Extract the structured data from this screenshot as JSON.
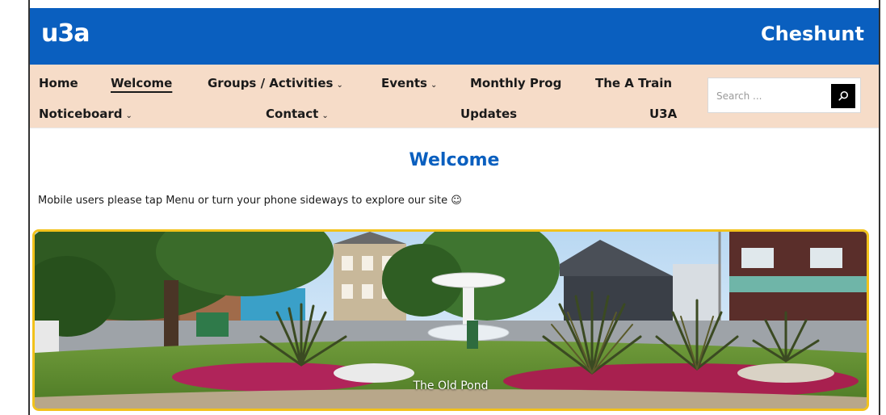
{
  "header": {
    "logo": "u3a",
    "site_name": "Cheshunt"
  },
  "nav": {
    "row1": [
      {
        "label": "Home",
        "has_dropdown": false,
        "active": false
      },
      {
        "label": "Welcome",
        "has_dropdown": false,
        "active": true
      },
      {
        "label": "Groups / Activities",
        "has_dropdown": true,
        "active": false
      },
      {
        "label": "Events",
        "has_dropdown": true,
        "active": false
      },
      {
        "label": "Monthly Prog",
        "has_dropdown": false,
        "active": false
      },
      {
        "label": "The A Train",
        "has_dropdown": false,
        "active": false
      }
    ],
    "row2": [
      {
        "label": "Noticeboard",
        "has_dropdown": true,
        "active": false
      },
      {
        "label": "Contact",
        "has_dropdown": true,
        "active": false
      },
      {
        "label": "Updates",
        "has_dropdown": false,
        "active": false
      },
      {
        "label": "U3A",
        "has_dropdown": false,
        "active": false
      }
    ],
    "chevron": "⌄"
  },
  "search": {
    "placeholder": "Search ...",
    "icon": "search-icon"
  },
  "main": {
    "title": "Welcome",
    "intro": "Mobile users please tap Menu or turn your phone sideways to explore our site ☺",
    "hero_caption": "The Old Pond"
  },
  "colors": {
    "brand_blue": "#0a5fbf",
    "nav_bg": "#f6dcc8",
    "hero_border": "#f2c21b"
  }
}
